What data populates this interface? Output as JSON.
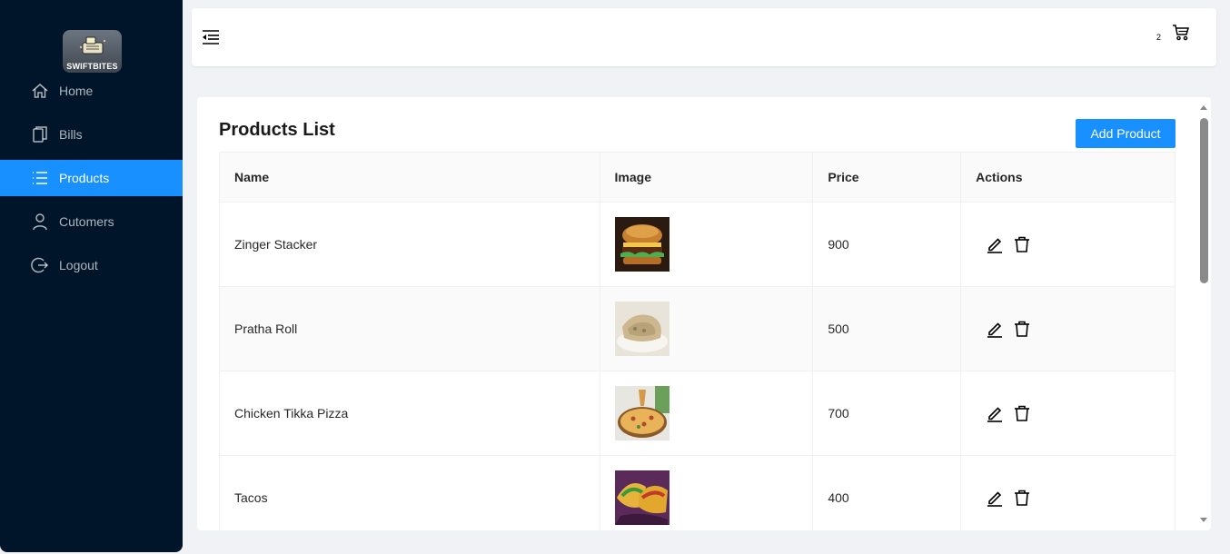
{
  "app": {
    "logo_text": "SWIFTBITES"
  },
  "sidebar": {
    "items": [
      {
        "label": "Home",
        "icon": "home-icon",
        "active": false
      },
      {
        "label": "Bills",
        "icon": "bills-icon",
        "active": false
      },
      {
        "label": "Products",
        "icon": "list-icon",
        "active": true
      },
      {
        "label": "Cutomers",
        "icon": "user-icon",
        "active": false
      },
      {
        "label": "Logout",
        "icon": "logout-icon",
        "active": false
      }
    ]
  },
  "header": {
    "cart_count": "2",
    "cart_icon": "shopping-cart-icon",
    "menu_icon": "menu-fold-icon"
  },
  "main": {
    "title": "Products List",
    "add_button": "Add Product",
    "table": {
      "headers": [
        "Name",
        "Image",
        "Price",
        "Actions"
      ],
      "rows": [
        {
          "name": "Zinger Stacker",
          "price": "900",
          "image": "burger-photo"
        },
        {
          "name": "Pratha Roll",
          "price": "500",
          "image": "paratha-roll-photo"
        },
        {
          "name": "Chicken Tikka Pizza",
          "price": "700",
          "image": "pizza-photo"
        },
        {
          "name": "Tacos",
          "price": "400",
          "image": "tacos-photo"
        }
      ]
    }
  },
  "colors": {
    "sidebar_bg": "#001529",
    "accent": "#1890ff",
    "page_bg": "#f0f2f5"
  }
}
